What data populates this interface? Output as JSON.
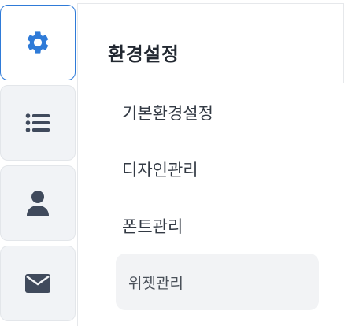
{
  "rail": {
    "tabs": [
      {
        "icon": "gear-icon",
        "active": true
      },
      {
        "icon": "list-icon",
        "active": false
      },
      {
        "icon": "user-icon",
        "active": false
      },
      {
        "icon": "envelope-icon",
        "active": false
      }
    ]
  },
  "panel": {
    "title": "환경설정",
    "items": [
      {
        "label": "기본환경설정"
      },
      {
        "label": "디자인관리"
      },
      {
        "label": "폰트관리"
      },
      {
        "label": "위젯관리"
      }
    ]
  },
  "colors": {
    "accent": "#2f7bd8",
    "icon": "#404a5c",
    "tab_bg": "#f1f3f6",
    "selected_bg": "#f2f3f5"
  }
}
